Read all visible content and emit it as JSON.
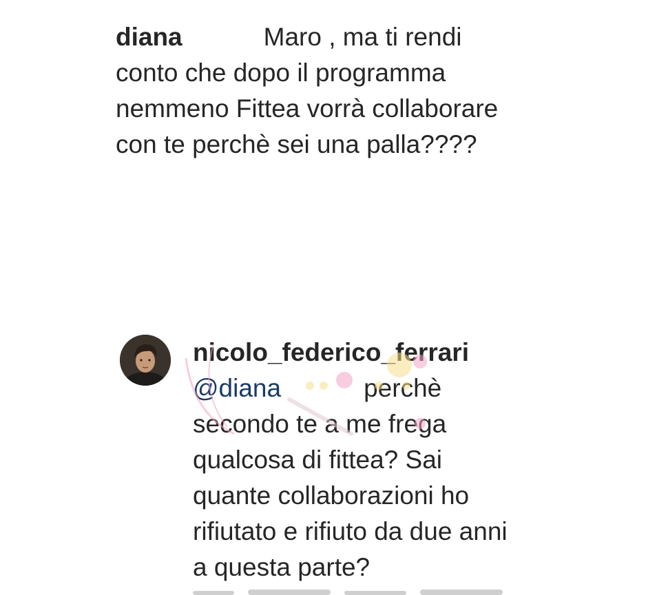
{
  "comment": {
    "username": "diana",
    "lines": [
      "Maro , ma ti rendi",
      "conto che dopo il programma",
      "nemmeno Fittea vorrà collaborare",
      "con te perchè sei una palla????"
    ]
  },
  "reply": {
    "avatar_icon": "profile-photo",
    "username": "nicolo_federico_ferrari",
    "mention": "@diana",
    "lines": [
      "perchè",
      "secondo te a me frega",
      "qualcosa di fittea? Sai",
      "quante collaborazioni ho",
      "rifiutato e rifiuto da due anni",
      "a questa parte?"
    ]
  },
  "watermark": {
    "icon": "pink-flower-watermark-icon",
    "color": "#f3a6c6"
  }
}
